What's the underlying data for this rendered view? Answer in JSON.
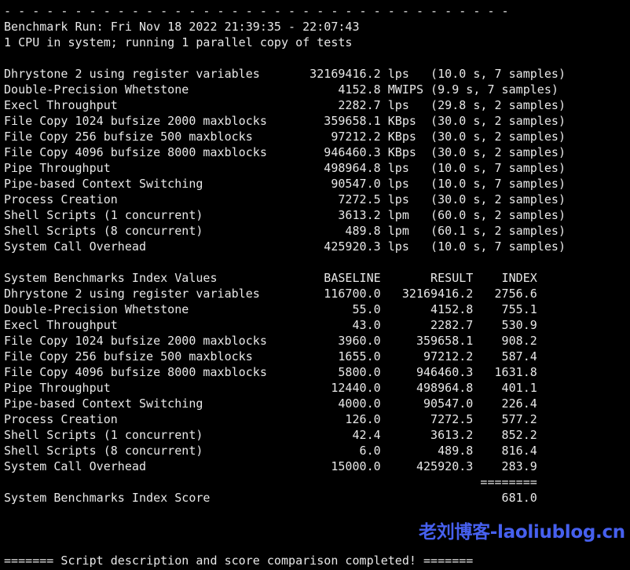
{
  "terminal": {
    "background_color": "#000000",
    "text_color": "#e8e8e8",
    "separator_top": "- - - - - - - - - - - - - - - - - - - - - - - - - - - - - - - - - - - -",
    "header": {
      "benchmark_run": "Benchmark Run: Fri Nov 18 2022 21:39:35 - 22:07:43",
      "cpu_line": "1 CPU in system; running 1 parallel copy of tests"
    },
    "raw_results": {
      "rows": [
        {
          "name": "Dhrystone 2 using register variables",
          "value": "32169416.2",
          "unit": "lps",
          "timing": "(10.0 s, 7 samples)"
        },
        {
          "name": "Double-Precision Whetstone",
          "value": "4152.8",
          "unit": "MWIPS",
          "timing": "(9.9 s, 7 samples)"
        },
        {
          "name": "Execl Throughput",
          "value": "2282.7",
          "unit": "lps",
          "timing": "(29.8 s, 2 samples)"
        },
        {
          "name": "File Copy 1024 bufsize 2000 maxblocks",
          "value": "359658.1",
          "unit": "KBps",
          "timing": "(30.0 s, 2 samples)"
        },
        {
          "name": "File Copy 256 bufsize 500 maxblocks",
          "value": "97212.2",
          "unit": "KBps",
          "timing": "(30.0 s, 2 samples)"
        },
        {
          "name": "File Copy 4096 bufsize 8000 maxblocks",
          "value": "946460.3",
          "unit": "KBps",
          "timing": "(30.0 s, 2 samples)"
        },
        {
          "name": "Pipe Throughput",
          "value": "498964.8",
          "unit": "lps",
          "timing": "(10.0 s, 7 samples)"
        },
        {
          "name": "Pipe-based Context Switching",
          "value": "90547.0",
          "unit": "lps",
          "timing": "(10.0 s, 7 samples)"
        },
        {
          "name": "Process Creation",
          "value": "7272.5",
          "unit": "lps",
          "timing": "(30.0 s, 2 samples)"
        },
        {
          "name": "Shell Scripts (1 concurrent)",
          "value": "3613.2",
          "unit": "lpm",
          "timing": "(60.0 s, 2 samples)"
        },
        {
          "name": "Shell Scripts (8 concurrent)",
          "value": "489.8",
          "unit": "lpm",
          "timing": "(60.1 s, 2 samples)"
        },
        {
          "name": "System Call Overhead",
          "value": "425920.3",
          "unit": "lps",
          "timing": "(10.0 s, 7 samples)"
        }
      ]
    },
    "index_table": {
      "title": "System Benchmarks Index Values",
      "columns": [
        "BASELINE",
        "RESULT",
        "INDEX"
      ],
      "rows": [
        {
          "name": "Dhrystone 2 using register variables",
          "baseline": "116700.0",
          "result": "32169416.2",
          "index": "2756.6"
        },
        {
          "name": "Double-Precision Whetstone",
          "baseline": "55.0",
          "result": "4152.8",
          "index": "755.1"
        },
        {
          "name": "Execl Throughput",
          "baseline": "43.0",
          "result": "2282.7",
          "index": "530.9"
        },
        {
          "name": "File Copy 1024 bufsize 2000 maxblocks",
          "baseline": "3960.0",
          "result": "359658.1",
          "index": "908.2"
        },
        {
          "name": "File Copy 256 bufsize 500 maxblocks",
          "baseline": "1655.0",
          "result": "97212.2",
          "index": "587.4"
        },
        {
          "name": "File Copy 4096 bufsize 8000 maxblocks",
          "baseline": "5800.0",
          "result": "946460.3",
          "index": "1631.8"
        },
        {
          "name": "Pipe Throughput",
          "baseline": "12440.0",
          "result": "498964.8",
          "index": "401.1"
        },
        {
          "name": "Pipe-based Context Switching",
          "baseline": "4000.0",
          "result": "90547.0",
          "index": "226.4"
        },
        {
          "name": "Process Creation",
          "baseline": "126.0",
          "result": "7272.5",
          "index": "577.2"
        },
        {
          "name": "Shell Scripts (1 concurrent)",
          "baseline": "42.4",
          "result": "3613.2",
          "index": "852.2"
        },
        {
          "name": "Shell Scripts (8 concurrent)",
          "baseline": "6.0",
          "result": "489.8",
          "index": "816.4"
        },
        {
          "name": "System Call Overhead",
          "baseline": "15000.0",
          "result": "425920.3",
          "index": "283.9"
        }
      ],
      "score_rule": "========",
      "score_label": "System Benchmarks Index Score",
      "score_value": "681.0"
    },
    "footer": {
      "completed_line": "======= Script description and score comparison completed! ======="
    }
  },
  "watermark": {
    "text": "老刘博客-laoliublog.cn",
    "color": "#4660ef"
  }
}
